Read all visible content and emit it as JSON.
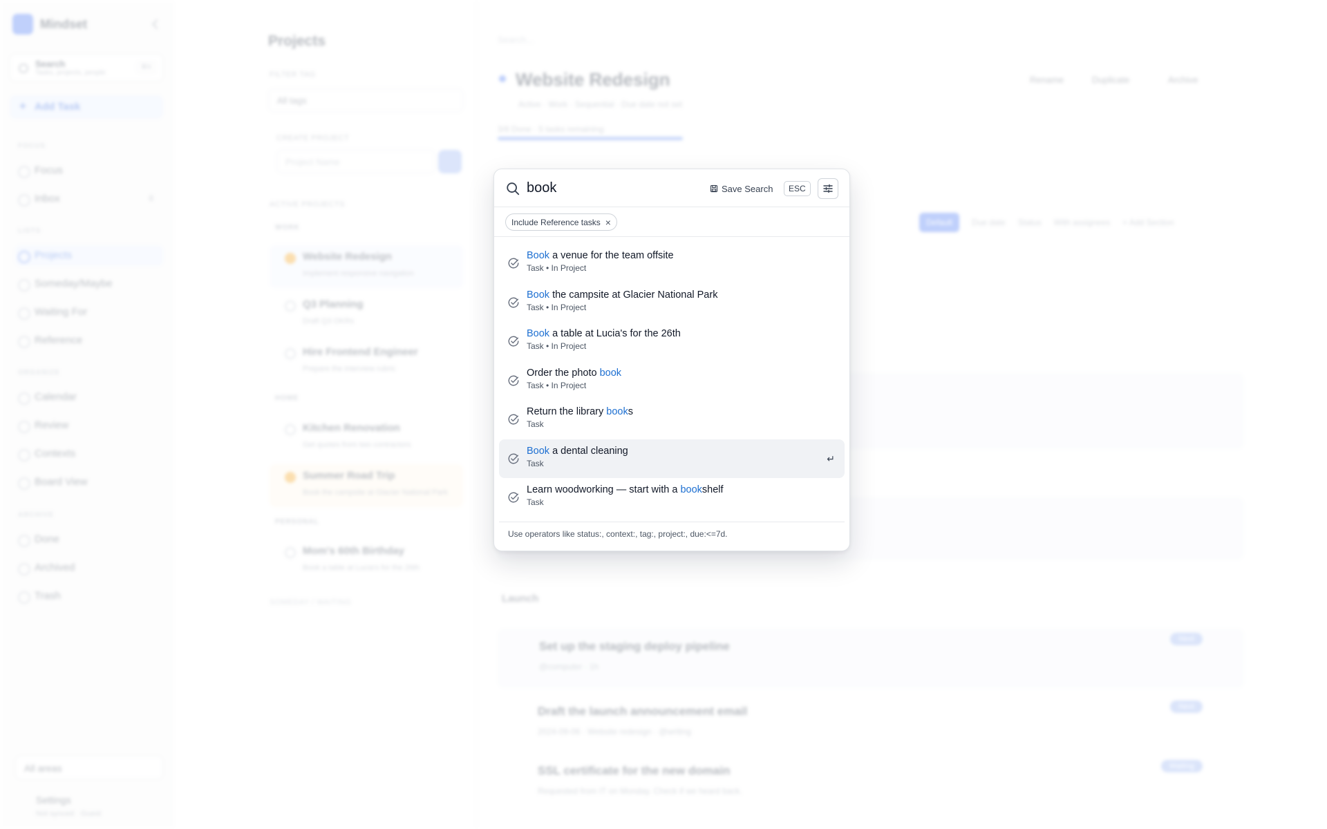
{
  "background": {
    "sidebar": {
      "brand": "Mindset",
      "search_title": "Search",
      "search_sub": "Tasks, projects, people",
      "search_kbd": "⌘K",
      "add_task": "Add Task",
      "section_focus": "FOCUS",
      "focus": "Focus",
      "inbox": "Inbox",
      "inbox_count": "8",
      "section_lists": "LISTS",
      "projects": "Projects",
      "someday": "Someday/Maybe",
      "waiting": "Waiting For",
      "reference": "Reference",
      "section_organize": "ORGANIZE",
      "calendar": "Calendar",
      "review": "Review",
      "contexts": "Contexts",
      "board": "Board View",
      "section_archive": "ARCHIVE",
      "done": "Done",
      "archived": "Archived",
      "trash": "Trash",
      "areas": "All areas",
      "settings": "Settings",
      "settings_sub": "Not synced · Guest"
    },
    "projects": {
      "title": "Projects",
      "filter_label": "FILTER TAG",
      "filter_value": "All tags",
      "create_label": "CREATE PROJECT",
      "create_placeholder": "Project Name",
      "active_label": "ACTIVE PROJECTS",
      "group_work": "WORK",
      "p1": "Website Redesign",
      "p1_sub": "Implement responsive navigation",
      "p2": "Q3 Planning",
      "p2_sub": "Draft Q3 OKRs",
      "p3": "Hire Frontend Engineer",
      "p3_sub": "Prepare the interview rubric",
      "group_home": "HOME",
      "p4": "Kitchen Renovation",
      "p4_sub": "Get quotes from two contractors",
      "p5": "Summer Road Trip",
      "p5_sub": "Book the campsite at Glacier National Park",
      "group_personal": "PERSONAL",
      "p6": "Mom's 60th Birthday",
      "p6_sub": "Book a table at Lucia's for the 26th",
      "footer": "SOMEDAY / WAITING"
    },
    "main": {
      "search_placeholder": "Search...",
      "title": "Website Redesign",
      "act_rename": "Rename",
      "act_duplicate": "Duplicate",
      "act_archive": "Archive",
      "meta": "Active · Work · Sequential · Due date not set",
      "progress_text": "3/8 Done · 5 tasks remaining",
      "filter_default": "Default",
      "filter_due": "Due date",
      "filter_status": "Status",
      "filter_unassigned": "With assignees",
      "filter_add": "+ Add Section",
      "section_launch": "Launch",
      "t1": "Set up the staging deploy pipeline",
      "t1_tags": "@computer · 1h",
      "t2": "Draft the launch announcement email",
      "t2_tags": "2024-09-06 · Website redesign · @writing",
      "t3": "SSL certificate for the new domain",
      "t3_tags": "Requested from IT on Monday. Check if we heard back.",
      "badge_next": "Next",
      "badge_waiting": "Waiting"
    }
  },
  "palette": {
    "query": "book",
    "save_search": "Save Search",
    "esc": "ESC",
    "chip": "Include Reference tasks",
    "results": [
      {
        "pre": "",
        "hl": "Book",
        "post": " a venue for the team offsite",
        "type": "Task",
        "loc": "In Project"
      },
      {
        "pre": "",
        "hl": "Book",
        "post": " the campsite at Glacier National Park",
        "type": "Task",
        "loc": "In Project"
      },
      {
        "pre": "",
        "hl": "Book",
        "post": " a table at Lucia's for the 26th",
        "type": "Task",
        "loc": "In Project"
      },
      {
        "pre": "Order the photo ",
        "hl": "book",
        "post": "",
        "type": "Task",
        "loc": "In Project"
      },
      {
        "pre": "Return the library ",
        "hl": "book",
        "post": "s",
        "type": "Task",
        "loc": ""
      },
      {
        "pre": "",
        "hl": "Book",
        "post": " a dental cleaning",
        "type": "Task",
        "loc": ""
      },
      {
        "pre": "Learn woodworking — start with a ",
        "hl": "book",
        "post": "shelf",
        "type": "Task",
        "loc": ""
      }
    ],
    "active_index": 5,
    "enter_glyph": "↵",
    "footer": "Use operators like status:, context:, tag:, project:, due:<=7d.",
    "colors": {
      "highlight": "#1d6fd1",
      "active_row": "#f0f2f5"
    },
    "icons": {
      "search": "search-icon",
      "save": "save-icon",
      "options": "sliders-icon",
      "result": "check-circle-icon",
      "remove_chip": "close-icon"
    }
  }
}
